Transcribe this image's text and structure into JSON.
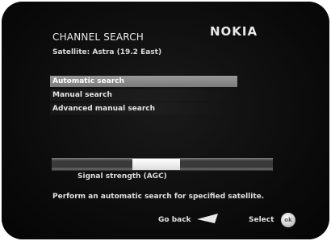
{
  "header": {
    "title": "CHANNEL SEARCH",
    "brand": "NOKIA",
    "satellite": "Satellite: Astra (19.2 East)"
  },
  "menu": {
    "items": [
      {
        "label": "Automatic search",
        "selected": true
      },
      {
        "label": "Manual search",
        "selected": false
      },
      {
        "label": "Advanced manual search",
        "selected": false
      }
    ]
  },
  "signal": {
    "label": "Signal strength (AGC)",
    "level": 0.34
  },
  "help_text": "Perform an automatic search for specified satellite.",
  "footer": {
    "back_label": "Go back",
    "select_label": "Select",
    "ok_icon_text": "ok"
  },
  "icons": {
    "back": "back-arrow-icon",
    "ok": "ok-button-icon"
  },
  "colors": {
    "background": "#0c0c0c",
    "text": "#e5e5e5",
    "selection": "#8a8a8a",
    "signal_fill": "#ffffff"
  }
}
